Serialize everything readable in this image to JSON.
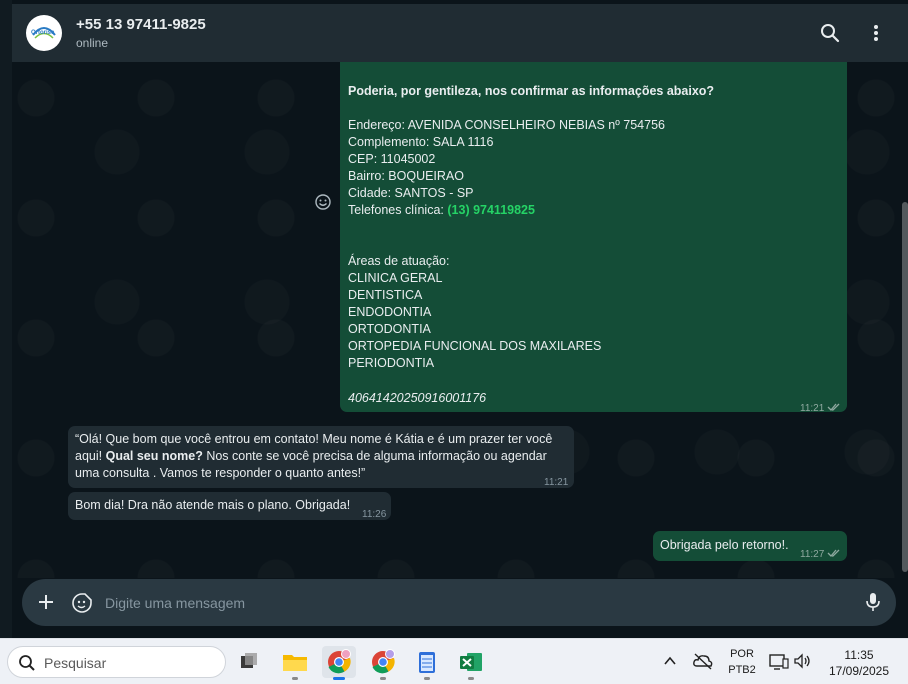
{
  "header": {
    "contact_name": "+55 13 97411-9825",
    "status": "online",
    "avatar_logo": "Ortorise"
  },
  "messages": {
    "main": {
      "question": "Poderia, por gentileza, nos confirmar as informações abaixo?",
      "endereco": "Endereço: AVENIDA CONSELHEIRO NEBIAS nº 754756",
      "complemento": "Complemento: SALA 1116",
      "cep": "CEP: 11045002",
      "bairro": "Bairro: BOQUEIRAO",
      "cidade": "Cidade: SANTOS - SP",
      "telefones_label": "Telefones clínica:",
      "telefones_value": "(13) 974119825",
      "areas_label": "Áreas de atuação:",
      "areas": [
        "CLINICA GERAL",
        "DENTISTICA",
        "ENDODONTIA",
        "ORTODONTIA",
        "ORTOPEDIA FUNCIONAL DOS MAXILARES",
        "PERIODONTIA"
      ],
      "code": "40641420250916001176",
      "time": "11:21"
    },
    "greeting": {
      "line1": "“Olá! Que bom que você entrou em contato! Meu nome é Kátia e é um prazer ter você",
      "line2_prefix": "aqui! ",
      "line2_bold": "Qual seu nome?",
      "line2_suffix": " Nos conte se você precisa de alguma informação ou agendar",
      "line3": "uma consulta . Vamos te responder o quanto antes!”",
      "time": "11:21"
    },
    "reply": {
      "text": "Bom dia! Dra não atende mais o plano. Obrigada!",
      "time": "11:26"
    },
    "thanks": {
      "text": "Obrigada pelo retorno!.",
      "time": "11:27"
    }
  },
  "composer": {
    "placeholder": "Digite uma mensagem"
  },
  "taskbar": {
    "search_placeholder": "Pesquisar",
    "language": "POR",
    "layout": "PTB2",
    "time": "11:35",
    "date": "17/09/2025"
  },
  "colors": {
    "outgoing_bubble": "#144d37",
    "incoming_bubble": "#202c33",
    "accent_green": "#25d366"
  }
}
